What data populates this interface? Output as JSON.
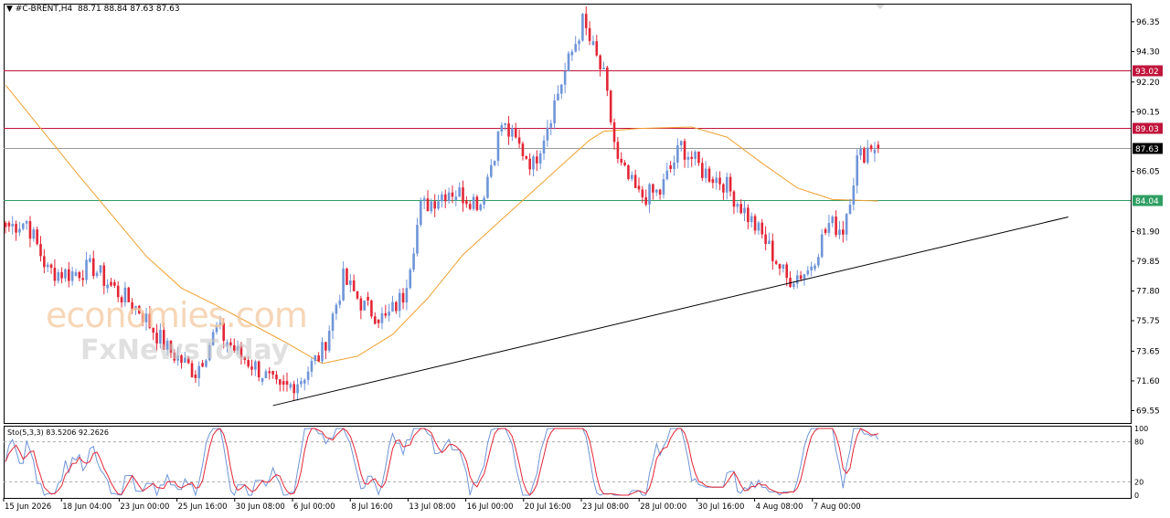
{
  "header": {
    "symbol": "#C-BRENT,H4",
    "ohlc": "88.71 88.84 87.63 87.63"
  },
  "oscillator": {
    "label": "Sto(5,3,3) 83.5206 92.2626"
  },
  "watermark": {
    "line1": "economies.com",
    "line2": "FxNewsToday"
  },
  "colors": {
    "bull": "#6f95d8",
    "bear": "#e32636",
    "ma": "#f0a030",
    "resistance": "#c0143c",
    "support": "#2e9e62",
    "last_price": "#999999",
    "trendline": "#000000",
    "stoch_main": "#6f95d8",
    "stoch_signal": "#e32636"
  },
  "chart_data": [
    {
      "type": "candlestick",
      "symbol": "#C-BRENT",
      "timeframe": "H4",
      "ylim": [
        68.7,
        97.6
      ],
      "y_ticks": [
        "96.35",
        "94.30",
        "92.20",
        "90.15",
        "88.10",
        "86.05",
        "84.00",
        "81.90",
        "79.85",
        "77.80",
        "75.75",
        "73.65",
        "71.60",
        "69.55"
      ],
      "x_ticks": [
        "15 Jun 2026",
        "18 Jun 04:00",
        "23 Jun 00:00",
        "25 Jun 16:00",
        "30 Jun 08:00",
        "6 Jul 00:00",
        "8 Jul 16:00",
        "13 Jul 08:00",
        "16 Jul 00:00",
        "20 Jul 16:00",
        "23 Jul 08:00",
        "28 Jul 00:00",
        "30 Jul 16:00",
        "4 Aug 08:00",
        "7 Aug 00:00"
      ],
      "levels": [
        {
          "label": "93.02",
          "value": 93.02,
          "kind": "resistance"
        },
        {
          "label": "89.03",
          "value": 89.03,
          "kind": "resistance"
        },
        {
          "label": "87.63",
          "value": 87.63,
          "kind": "last_price"
        },
        {
          "label": "84.04",
          "value": 84.04,
          "kind": "support"
        }
      ],
      "trendline": {
        "from_bar": 76,
        "from_price": 69.9,
        "to_bar": 302,
        "to_price": 82.9
      },
      "close_anchors": [
        [
          0,
          82.2
        ],
        [
          6,
          82.6
        ],
        [
          12,
          79.2
        ],
        [
          18,
          79.0
        ],
        [
          25,
          79.4
        ],
        [
          30,
          78.1
        ],
        [
          38,
          76.5
        ],
        [
          46,
          73.8
        ],
        [
          54,
          72.2
        ],
        [
          60,
          75.2
        ],
        [
          66,
          73.5
        ],
        [
          72,
          72.4
        ],
        [
          78,
          70.8
        ],
        [
          84,
          71.8
        ],
        [
          90,
          73.6
        ],
        [
          96,
          78.6
        ],
        [
          102,
          76.7
        ],
        [
          108,
          75.8
        ],
        [
          113,
          77.5
        ],
        [
          118,
          83.5
        ],
        [
          126,
          84.8
        ],
        [
          135,
          83.9
        ],
        [
          141,
          89.3
        ],
        [
          150,
          86.5
        ],
        [
          158,
          92.2
        ],
        [
          164,
          96.3
        ],
        [
          170,
          92.5
        ],
        [
          174,
          86.6
        ],
        [
          180,
          84.3
        ],
        [
          186,
          84.6
        ],
        [
          192,
          87.8
        ],
        [
          198,
          86.1
        ],
        [
          204,
          85.3
        ],
        [
          210,
          83.3
        ],
        [
          216,
          81.2
        ],
        [
          222,
          78.6
        ],
        [
          228,
          79.2
        ],
        [
          234,
          82.4
        ],
        [
          238,
          82.1
        ],
        [
          242,
          86.8
        ],
        [
          246,
          87.9
        ],
        [
          248,
          87.63
        ]
      ],
      "moving_average": [
        [
          0,
          92.0
        ],
        [
          10,
          89.0
        ],
        [
          20,
          86.0
        ],
        [
          30,
          83.1
        ],
        [
          40,
          80.2
        ],
        [
          50,
          78.0
        ],
        [
          60,
          76.8
        ],
        [
          70,
          75.5
        ],
        [
          80,
          74.2
        ],
        [
          90,
          72.8
        ],
        [
          100,
          73.3
        ],
        [
          110,
          74.8
        ],
        [
          120,
          77.3
        ],
        [
          130,
          80.3
        ],
        [
          140,
          82.5
        ],
        [
          150,
          84.7
        ],
        [
          160,
          86.9
        ],
        [
          166,
          88.2
        ],
        [
          170,
          88.8
        ],
        [
          180,
          89.0
        ],
        [
          195,
          89.1
        ],
        [
          205,
          88.4
        ],
        [
          215,
          86.6
        ],
        [
          225,
          84.9
        ],
        [
          235,
          84.1
        ],
        [
          248,
          84.0
        ]
      ],
      "total_bars": 249
    },
    {
      "type": "line",
      "name": "Sto(5,3,3)",
      "ylim": [
        0,
        100
      ],
      "y_ticks": [
        "100",
        "80",
        "20",
        "0"
      ],
      "levels": [
        80,
        20
      ],
      "last_main": 83.5206,
      "last_signal": 92.2626
    }
  ]
}
